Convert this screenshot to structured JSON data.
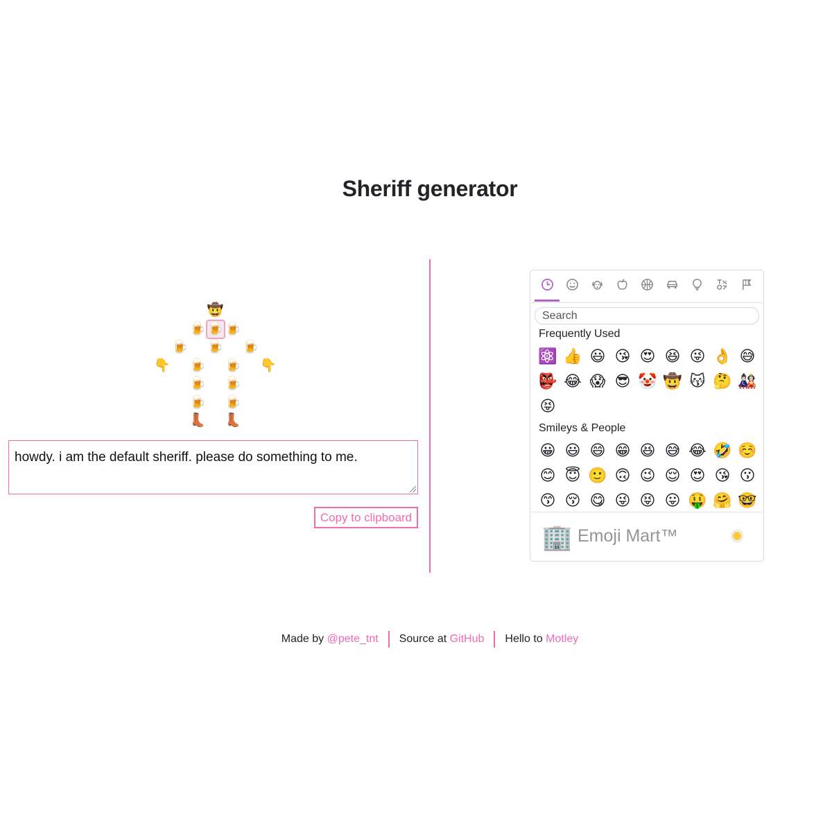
{
  "page": {
    "title": "Sheriff generator"
  },
  "sheriff": {
    "hat": "🤠",
    "body": "🍺",
    "hands": "👇",
    "boots": "👢",
    "text": "howdy. i am the default sheriff. please do something to me.",
    "copy_label": "Copy to clipboard"
  },
  "picker": {
    "categories": [
      "clock-icon",
      "smiley-icon",
      "animal-icon",
      "food-icon",
      "activity-icon",
      "travel-icon",
      "objects-icon",
      "symbols-icon",
      "flags-icon"
    ],
    "search_placeholder": "Search",
    "frequent_title": "Frequently Used",
    "frequent": [
      "⚛️",
      "👍",
      "😃",
      "😘",
      "😍",
      "😆",
      "😜",
      "👌",
      "😅",
      "👺",
      "😂",
      "😱",
      "😎",
      "🤡",
      "🤠",
      "😽",
      "🤔",
      "🎎",
      "😝"
    ],
    "people_title": "Smileys & People",
    "people": [
      "😀",
      "😃",
      "😄",
      "😁",
      "😆",
      "😅",
      "😂",
      "🤣",
      "☺️",
      "😊",
      "😇",
      "🙂",
      "🙃",
      "😉",
      "😌",
      "😍",
      "😘",
      "😗",
      "😙",
      "😚",
      "😋",
      "😜",
      "😝",
      "😛",
      "🤑",
      "🤗",
      "🤓"
    ],
    "preview_emoji": "🏢",
    "preview_name": "Emoji Mart™",
    "skin_tone_color": "#ffc83d"
  },
  "footer": {
    "made_by_prefix": "Made by",
    "made_by_link": "@pete_tnt",
    "source_prefix": "Source at",
    "source_link": "GitHub",
    "hello_prefix": "Hello to",
    "hello_link": "Motley"
  },
  "colors": {
    "accent": "#f06bb0",
    "picker_accent": "#ae65c5"
  }
}
